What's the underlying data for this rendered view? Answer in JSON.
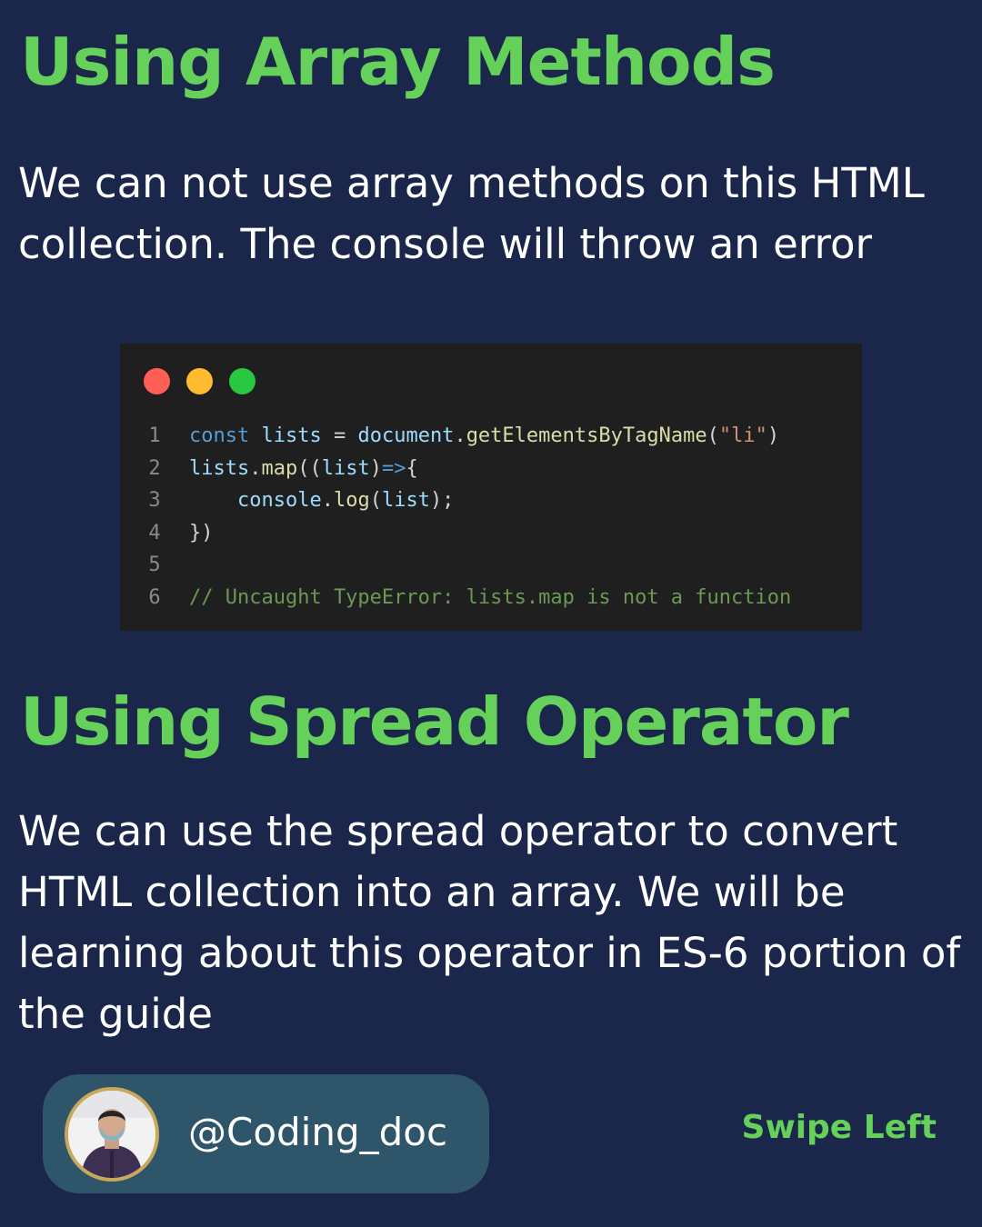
{
  "section1": {
    "title": "Using Array Methods",
    "body": "We can not use array methods on this HTML collection. The console will throw an error"
  },
  "code_window": {
    "dots": [
      "red",
      "yellow",
      "green"
    ],
    "dot_colors": {
      "red": "#ff5f57",
      "yellow": "#febc2e",
      "green": "#28c840"
    },
    "line_numbers": [
      "1",
      "2",
      "3",
      "4",
      "5",
      "6"
    ],
    "lines": [
      [
        {
          "t": "const ",
          "c": "kw"
        },
        {
          "t": "lists",
          "c": "var"
        },
        {
          "t": " = ",
          "c": "pl"
        },
        {
          "t": "document",
          "c": "var"
        },
        {
          "t": ".",
          "c": "pl"
        },
        {
          "t": "getElementsByTagName",
          "c": "fn"
        },
        {
          "t": "(",
          "c": "pl"
        },
        {
          "t": "\"li\"",
          "c": "str"
        },
        {
          "t": ")",
          "c": "pl"
        }
      ],
      [
        {
          "t": "lists",
          "c": "var"
        },
        {
          "t": ".",
          "c": "pl"
        },
        {
          "t": "map",
          "c": "fn"
        },
        {
          "t": "((",
          "c": "pl"
        },
        {
          "t": "list",
          "c": "var"
        },
        {
          "t": ")",
          "c": "pl"
        },
        {
          "t": "=>",
          "c": "kw"
        },
        {
          "t": "{",
          "c": "pl"
        }
      ],
      [
        {
          "t": "    ",
          "c": "pl"
        },
        {
          "t": "console",
          "c": "var"
        },
        {
          "t": ".",
          "c": "pl"
        },
        {
          "t": "log",
          "c": "fn"
        },
        {
          "t": "(",
          "c": "pl"
        },
        {
          "t": "list",
          "c": "var"
        },
        {
          "t": ");",
          "c": "pl"
        }
      ],
      [
        {
          "t": "})",
          "c": "pl"
        }
      ],
      [],
      [
        {
          "t": "// Uncaught TypeError: lists.map is not a function",
          "c": "cm"
        }
      ]
    ]
  },
  "section2": {
    "title": "Using Spread Operator",
    "body": "We can use the spread operator to convert HTML collection into an array. We will be learning about this operator in ES-6 portion of the guide"
  },
  "profile": {
    "handle": "@Coding_doc"
  },
  "swipe_label": "Swipe Left",
  "colors": {
    "background": "#1b274a",
    "heading": "#65d15a",
    "profile_pill": "#2e5569",
    "avatar_ring": "#c9a85a"
  }
}
